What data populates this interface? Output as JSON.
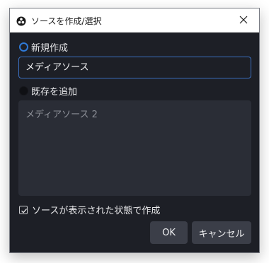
{
  "window": {
    "title": "ソースを作成/選択"
  },
  "create_new": {
    "label": "新規作成",
    "selected": true,
    "name_value": "メディアソース"
  },
  "add_existing": {
    "label": "既存を追加",
    "selected": false,
    "items": [
      "メディアソース 2"
    ]
  },
  "visible_option": {
    "label": "ソースが表示された状態で作成",
    "checked": true
  },
  "buttons": {
    "ok": "OK",
    "cancel": "キャンセル"
  },
  "colors": {
    "dialog_bg": "#1d1f26",
    "accent": "#2f7ad8",
    "button_bg": "#3b3e48",
    "list_bg": "#2a2d36"
  }
}
